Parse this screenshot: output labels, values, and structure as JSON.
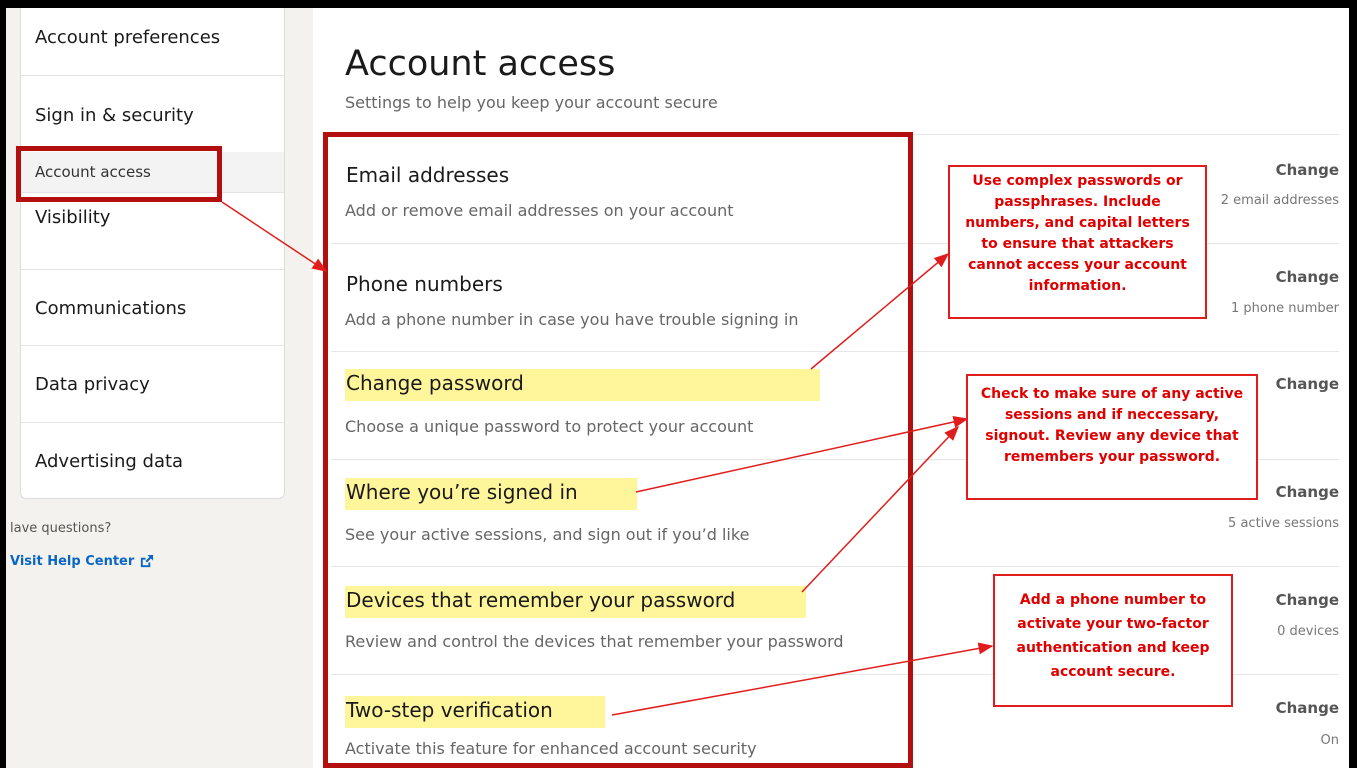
{
  "sidebar": {
    "items": [
      {
        "label": "Account preferences"
      },
      {
        "label": "Sign in & security"
      },
      {
        "label": "Account access"
      },
      {
        "label": "Visibility"
      },
      {
        "label": "Communications"
      },
      {
        "label": "Data privacy"
      },
      {
        "label": "Advertising data"
      }
    ],
    "help_question": "lave questions?",
    "help_link": "Visit Help Center"
  },
  "main": {
    "title": "Account access",
    "subtitle": "Settings to help you keep your account secure",
    "rows": [
      {
        "title": "Email addresses",
        "desc": "Add or remove email addresses on your account",
        "action": "Change",
        "meta": "2 email addresses"
      },
      {
        "title": "Phone numbers",
        "desc": "Add a phone number in case you have trouble signing in",
        "action": "Change",
        "meta": "1 phone number"
      },
      {
        "title": "Change password",
        "desc": "Choose a unique password to protect your account",
        "action": "Change",
        "meta": ""
      },
      {
        "title": "Where you’re signed in",
        "desc": "See your active sessions, and sign out if you’d like",
        "action": "Change",
        "meta": "5 active sessions"
      },
      {
        "title": "Devices that remember your password",
        "desc": "Review and control the devices that remember your password",
        "action": "Change",
        "meta": "0 devices"
      },
      {
        "title": "Two-step verification",
        "desc": "Activate this feature for enhanced account security",
        "action": "Change",
        "meta": "On"
      }
    ]
  },
  "annotations": {
    "password_tip": "Use complex passwords or passphrases. Include numbers, and capital letters to ensure that attackers cannot access your account information.",
    "sessions_tip": "Check to make sure of any active sessions and if neccessary, signout. Review any device that remembers your password.",
    "two_factor_tip": "Add a phone number to activate your two-factor authentication and keep account secure."
  },
  "colors": {
    "annotation_red": "#e00000",
    "highlight_yellow": "#fff59a",
    "link_blue": "#0a66c2"
  }
}
